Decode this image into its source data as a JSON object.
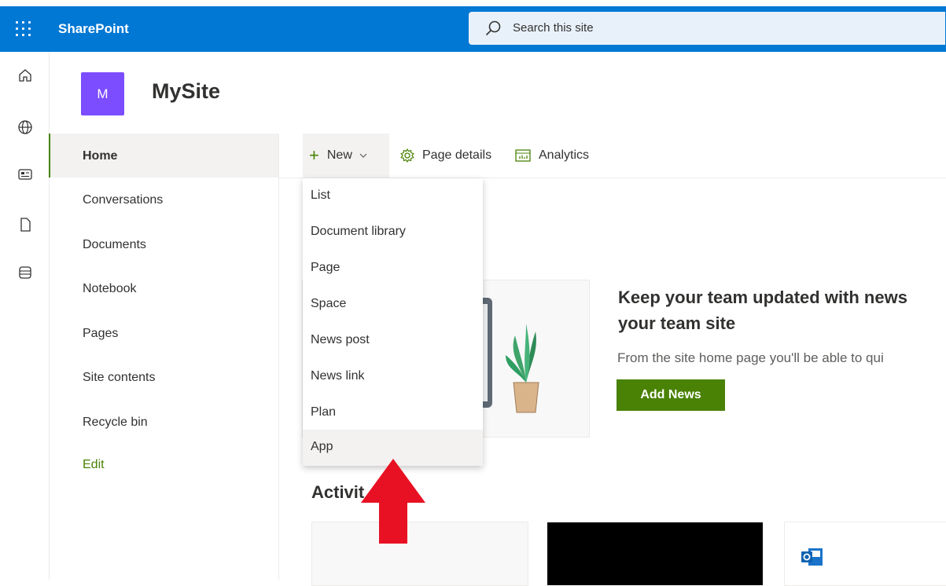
{
  "suite_bar": {
    "app_name": "SharePoint",
    "search_placeholder": "Search this site",
    "accent": "#0078d4"
  },
  "site": {
    "logo_letter": "M",
    "title": "MySite"
  },
  "rail": {
    "icons": [
      "home-icon",
      "globe-icon",
      "news-icon",
      "document-icon",
      "list-icon"
    ]
  },
  "left_nav": {
    "items": [
      {
        "label": "Home",
        "selected": true
      },
      {
        "label": "Conversations"
      },
      {
        "label": "Documents"
      },
      {
        "label": "Notebook"
      },
      {
        "label": "Pages"
      },
      {
        "label": "Site contents"
      },
      {
        "label": "Recycle bin"
      }
    ],
    "edit_label": "Edit"
  },
  "command_bar": {
    "new_label": "New",
    "page_details_label": "Page details",
    "analytics_label": "Analytics"
  },
  "new_menu": {
    "items": [
      "List",
      "Document library",
      "Page",
      "Space",
      "News post",
      "News link",
      "Plan",
      "App"
    ],
    "hovered": "App"
  },
  "news": {
    "heading": "Keep your team updated with news your team site",
    "body": "From the site home page you'll be able to qui",
    "button_label": "Add News"
  },
  "activity": {
    "title": "Activit"
  },
  "colors": {
    "brand_green": "#498205",
    "annotation_arrow": "#e81123"
  }
}
